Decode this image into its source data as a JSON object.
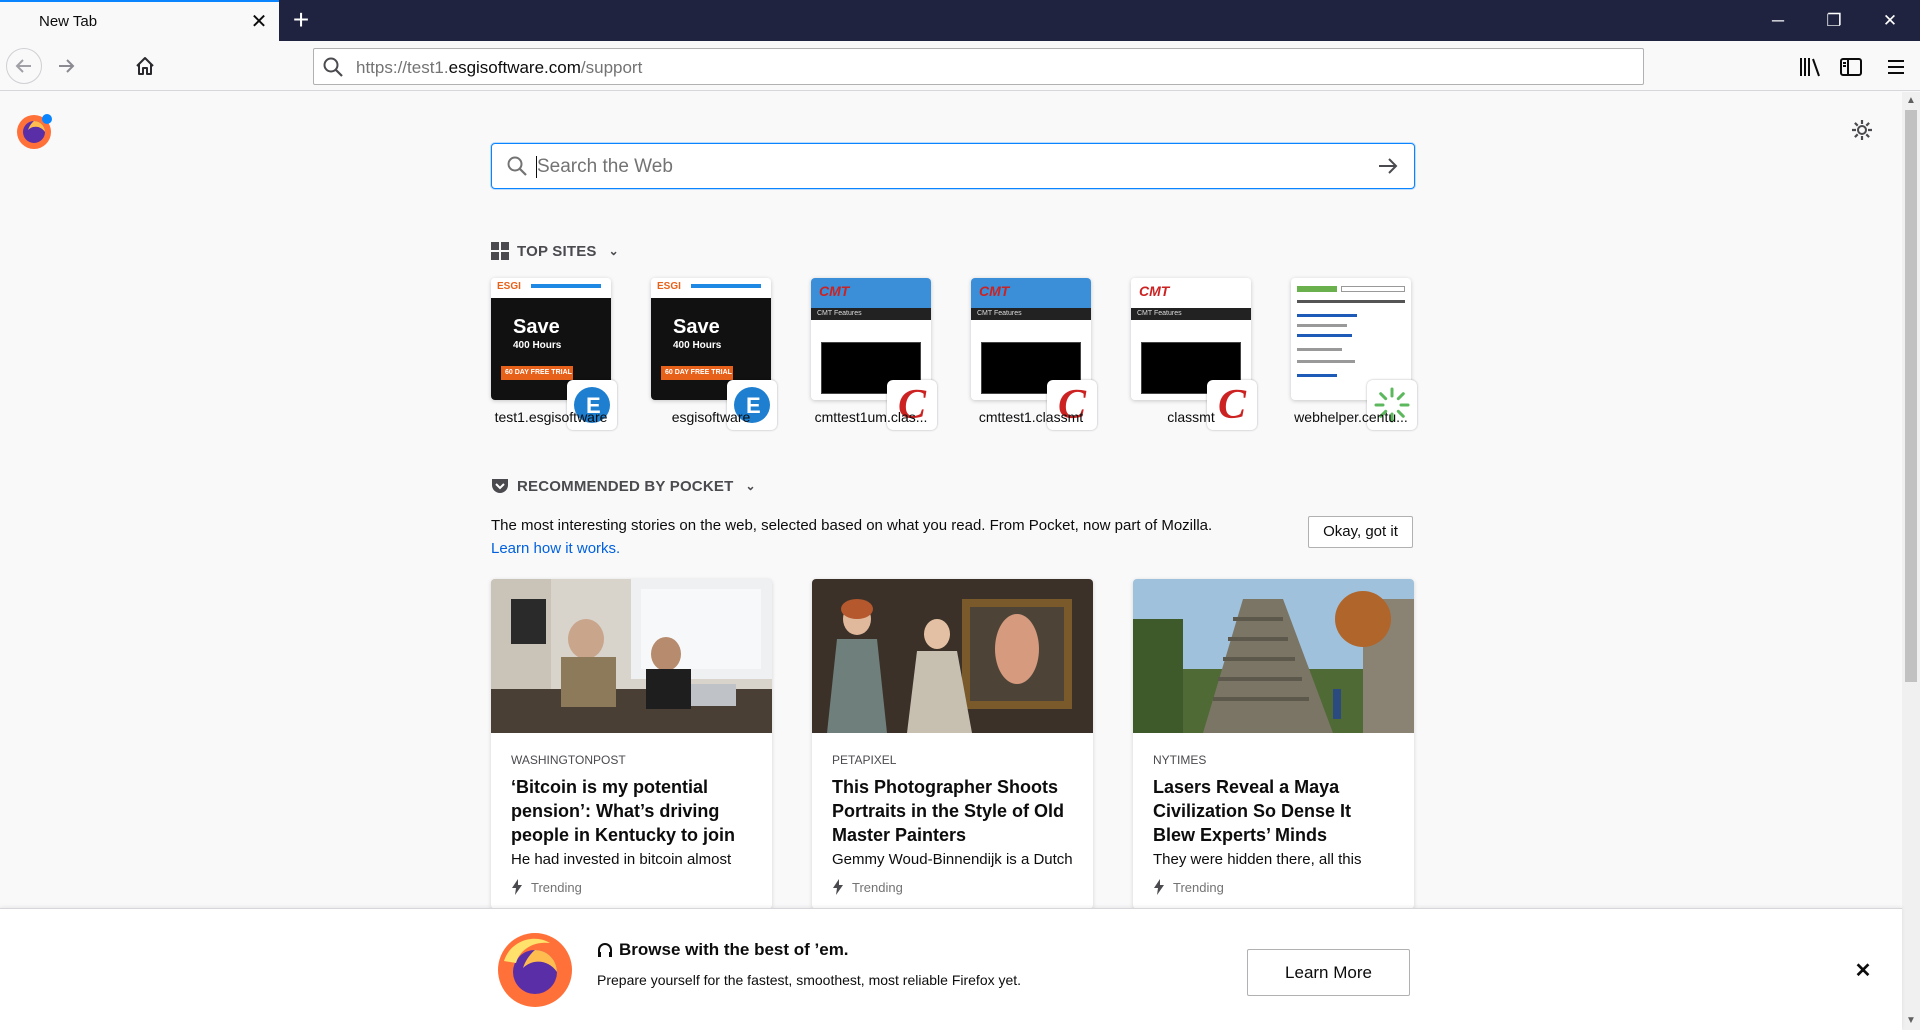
{
  "tab": {
    "title": "New Tab",
    "close": "✕"
  },
  "newtab": "+",
  "window_controls": {
    "minimize": "─",
    "restore": "❐",
    "close": "✕"
  },
  "url": {
    "prefix": "https://test1.",
    "domain": "esgisoftware.com",
    "path": "/support"
  },
  "search": {
    "placeholder": "Search the Web"
  },
  "top_sites": {
    "header": "TOP SITES",
    "sites": [
      {
        "label": "test1.esgisoftware"
      },
      {
        "label": "esgisoftware"
      },
      {
        "label": "cmttest1um.clas..."
      },
      {
        "label": "cmttest1.classmt"
      },
      {
        "label": "classmt"
      },
      {
        "label": "webhelper.centu..."
      }
    ],
    "thumb_text": {
      "esgi_logo": "ESGI",
      "save": "Save",
      "hours": "400 Hours",
      "trial": "60 DAY FREE TRIAL",
      "cmt_logo": "CMT",
      "cmt_features": "CMT Features"
    }
  },
  "pocket": {
    "header": "RECOMMENDED BY POCKET",
    "description": "The most interesting stories on the web, selected based on what you read. From Pocket, now part of Mozilla.",
    "learn_link": "Learn how it works.",
    "ok_button": "Okay, got it",
    "cards": [
      {
        "source": "WASHINGTONPOST",
        "title": "‘Bitcoin is my potential pension’: What’s driving people in Kentucky to join",
        "excerpt": "He had invested in bitcoin almost",
        "context": "Trending"
      },
      {
        "source": "PETAPIXEL",
        "title": "This Photographer Shoots Portraits in the Style of Old Master Painters",
        "excerpt": "Gemmy Woud-Binnendijk is a Dutch",
        "context": "Trending"
      },
      {
        "source": "NYTIMES",
        "title": "Lasers Reveal a Maya Civilization So Dense It Blew Experts’ Minds",
        "excerpt": "They were hidden there, all this",
        "context": "Trending"
      }
    ]
  },
  "snippet": {
    "title": "Browse with the best of ’em.",
    "text": "Prepare yourself for the fastest, smoothest, most reliable Firefox yet.",
    "button": "Learn More",
    "close": "✕"
  },
  "colors": {
    "accent": "#0a84ff",
    "tabstrip": "#202340",
    "link": "#0060df"
  }
}
